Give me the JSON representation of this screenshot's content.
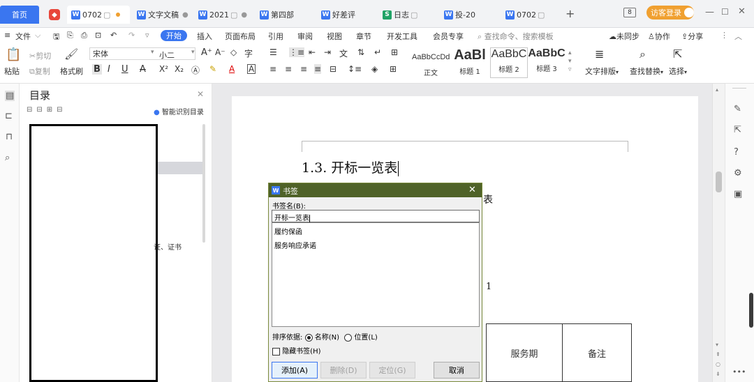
{
  "tabs": {
    "home": "首页",
    "items": [
      {
        "label": "0702"
      },
      {
        "label": "文字文稿"
      },
      {
        "label": "2021"
      },
      {
        "label": "第四部"
      },
      {
        "label": "好差评"
      },
      {
        "label": "日志"
      },
      {
        "label": "投-20"
      },
      {
        "label": "0702"
      }
    ],
    "add": "+",
    "page_counter": "8",
    "login": "访客登录"
  },
  "menu": {
    "file": "文件",
    "items": [
      "开始",
      "插入",
      "页面布局",
      "引用",
      "审阅",
      "视图",
      "章节",
      "开发工具",
      "会员专享"
    ],
    "search_placeholder": "查找命令、搜索模板",
    "sync": "未同步",
    "collab": "协作",
    "share": "分享"
  },
  "ribbon": {
    "paste": "粘贴",
    "cut": "剪切",
    "copy": "复制",
    "format_painter": "格式刷",
    "font_name": "宋体",
    "font_size": "小二",
    "styles": [
      {
        "sample": "AaBbCcDd",
        "label": "正文"
      },
      {
        "sample": "AaBl",
        "label": "标题 1"
      },
      {
        "sample": "AaBbC",
        "label": "标题 2"
      },
      {
        "sample": "AaBbC",
        "label": "标题 3"
      }
    ],
    "text_layout": "文字排版",
    "find_replace": "查找替换",
    "select": "选择"
  },
  "nav": {
    "title": "目录",
    "smart_toc": "智能识别目录",
    "partial_text": "证、证书"
  },
  "document": {
    "heading": "1.3. 开标一览表",
    "partial_char": "表",
    "number": "1",
    "table_headers": [
      "服务期",
      "备注"
    ]
  },
  "dialog": {
    "title": "书签",
    "name_label": "书签名(B):",
    "name_value": "开标一览表",
    "bookmarks": [
      "履约保函",
      "服务响应承诺"
    ],
    "sort_label": "排序依据:",
    "sort_name": "名称(N)",
    "sort_position": "位置(L)",
    "hide_label": "隐藏书签(H)",
    "buttons": {
      "add": "添加(A)",
      "delete": "删除(D)",
      "locate": "定位(G)",
      "cancel": "取消"
    }
  },
  "colors": {
    "dialog_title_bg": "#4f6228",
    "accent": "#3a76f0",
    "login_badge": "#f0a030"
  }
}
